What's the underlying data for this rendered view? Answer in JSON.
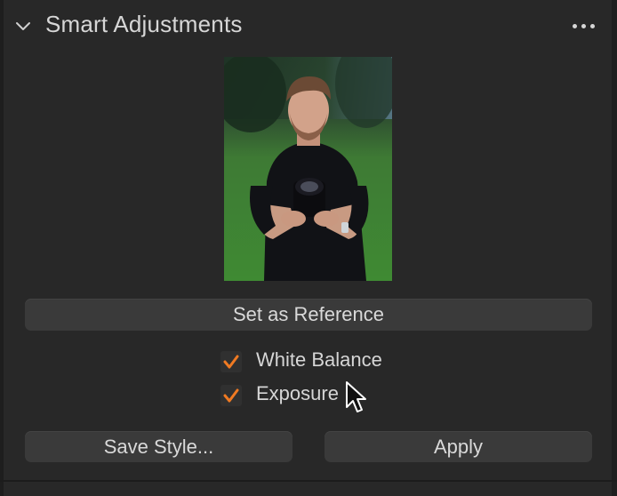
{
  "panel": {
    "title": "Smart Adjustments",
    "chevron_icon": "chevron-down-icon",
    "more_icon": "more-options-icon"
  },
  "reference_image": {
    "description_icon": "photo-thumbnail"
  },
  "buttons": {
    "set_reference": "Set as Reference",
    "save_style": "Save Style...",
    "apply": "Apply"
  },
  "options": [
    {
      "label": "White Balance",
      "checked": true
    },
    {
      "label": "Exposure",
      "checked": true
    }
  ],
  "colors": {
    "accent_check": "#f07a22",
    "background": "#282828",
    "button": "#3a3a3a",
    "text": "#d6d6d6"
  }
}
